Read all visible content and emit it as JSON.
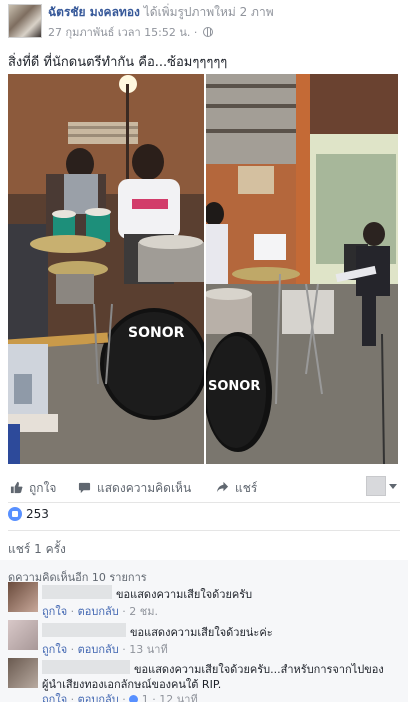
{
  "post": {
    "author": "ฉัตรชัย มงคลทอง",
    "action": "ได้เพิ่มรูปภาพใหม่ 2 ภาพ",
    "time": "27 กุมภาพันธ์ เวลา 15:52 น.",
    "separator": "·",
    "text": "สิ่งที่ดี ที่นักดนตรีทำกัน คือ...ซ้อมๆๆๆๆๆ"
  },
  "photos": {
    "left_drum_logo": "SONOR",
    "right_drum_logo": "SONOR"
  },
  "actions": {
    "like": "ถูกใจ",
    "comment": "แสดงความคิดเห็น",
    "share": "แชร์"
  },
  "stats": {
    "likes": "253",
    "shares": "แชร์ 1 ครั้ง"
  },
  "comments": {
    "more": "ดูความคิดเห็นอีก 10 รายการ",
    "items": [
      {
        "text": "ขอแสดงความเสียใจด้วยครับ",
        "like": "ถูกใจ",
        "reply": "ตอบกลับ",
        "sep": "·",
        "time": "2 ชม."
      },
      {
        "text": "ขอแสดงความเสียใจด้วยน่ะค่ะ",
        "like": "ถูกใจ",
        "reply": "ตอบกลับ",
        "sep": "·",
        "time": "13 นาที"
      },
      {
        "text_line1": "ขอแสดงความเสียใจด้วยครับ...สำหรับการจากไปของ",
        "text_line2": "ผู้นำเสียงทองเอกลักษณ์ของคนใต้ RIP.",
        "like": "ถูกใจ",
        "reply": "ตอบกลับ",
        "sep": "·",
        "like_count": "1",
        "time": "12 นาที"
      }
    ]
  },
  "colors": {
    "link": "#365899",
    "like_blue": "#5890ff",
    "muted": "#90949c"
  }
}
